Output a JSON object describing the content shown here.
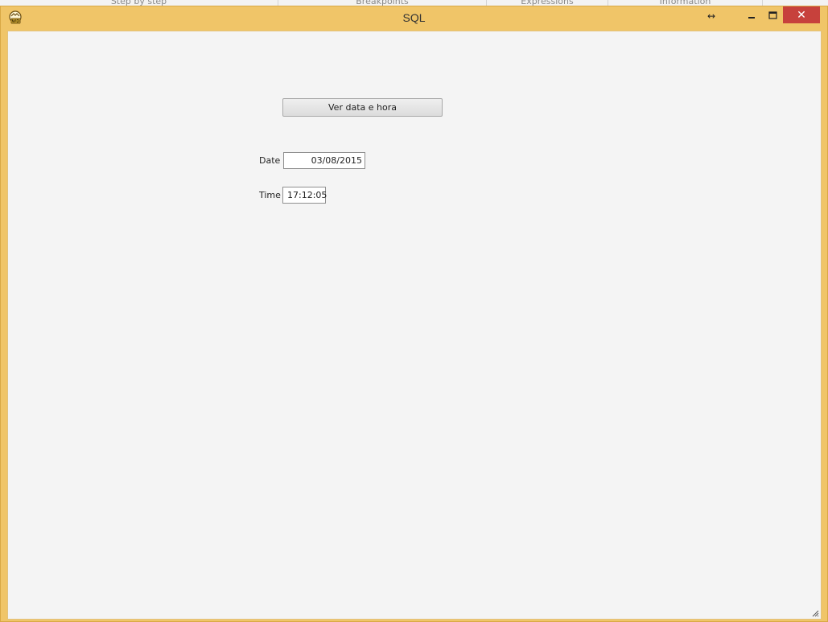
{
  "background_tabs": [
    "Step by step",
    "Breakpoints",
    "Expressions",
    "Information"
  ],
  "window": {
    "title": "SQL",
    "icon": "wd-app-icon",
    "controls": {
      "resize": "↔",
      "minimize": "minimize-icon",
      "maximize": "maximize-icon",
      "close": "✕"
    },
    "accent_color": "#f0c568",
    "close_color": "#c7413c"
  },
  "form": {
    "button_label": "Ver data e hora",
    "date_label": "Date",
    "date_value": "03/08/2015",
    "time_label": "Time",
    "time_value": "17:12:05"
  }
}
